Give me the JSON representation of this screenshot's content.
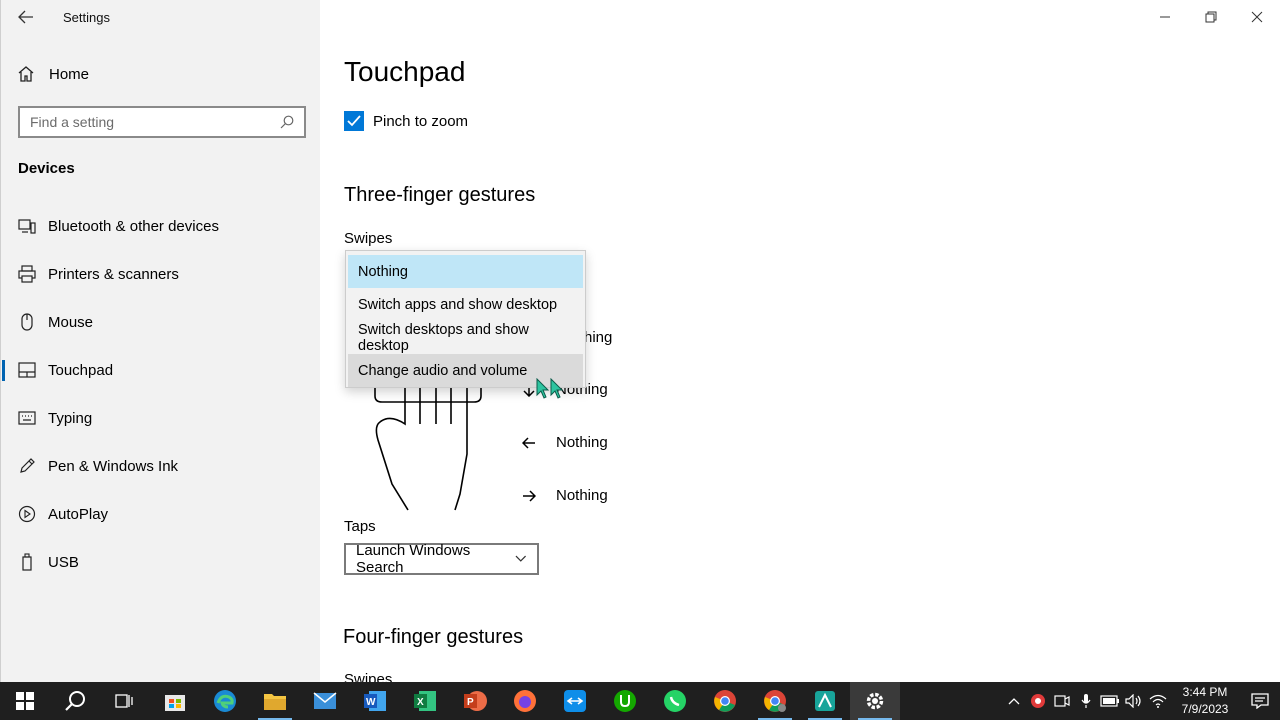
{
  "window": {
    "title": "Settings",
    "back_icon": "back-arrow-icon"
  },
  "sidebar": {
    "home_label": "Home",
    "search_placeholder": "Find a setting",
    "section_title": "Devices",
    "items": [
      {
        "label": "Bluetooth & other devices",
        "icon": "bluetooth-devices-icon"
      },
      {
        "label": "Printers & scanners",
        "icon": "printer-icon"
      },
      {
        "label": "Mouse",
        "icon": "mouse-icon"
      },
      {
        "label": "Touchpad",
        "icon": "touchpad-icon",
        "active": true
      },
      {
        "label": "Typing",
        "icon": "keyboard-icon"
      },
      {
        "label": "Pen & Windows Ink",
        "icon": "pen-icon"
      },
      {
        "label": "AutoPlay",
        "icon": "autoplay-icon"
      },
      {
        "label": "USB",
        "icon": "usb-icon"
      }
    ]
  },
  "main": {
    "page_title": "Touchpad",
    "pinch_to_zoom": {
      "label": "Pinch to zoom",
      "checked": true
    },
    "three_finger": {
      "heading": "Three-finger gestures",
      "swipes_label": "Swipes",
      "partial_text": "hing",
      "gestures": [
        {
          "direction": "down",
          "value": "Nothing"
        },
        {
          "direction": "left",
          "value": "Nothing"
        },
        {
          "direction": "right",
          "value": "Nothing"
        }
      ],
      "taps_label": "Taps",
      "taps_value": "Launch Windows Search"
    },
    "four_finger": {
      "heading": "Four-finger gestures",
      "swipes_label": "Swipes"
    }
  },
  "dropdown": {
    "options": [
      "Nothing",
      "Switch apps and show desktop",
      "Switch desktops and show desktop",
      "Change audio and volume"
    ],
    "selected_index": 0,
    "hover_index": 3
  },
  "taskbar": {
    "apps": [
      "start-icon",
      "search-icon",
      "task-view-icon",
      "store-icon",
      "edge-icon",
      "file-explorer-icon",
      "mail-icon",
      "word-icon",
      "excel-icon",
      "powerpoint-icon",
      "firefox-icon",
      "teamviewer-icon",
      "upwork-icon",
      "whatsapp-icon",
      "chrome-icon",
      "chrome-profile-icon",
      "video-editor-icon",
      "settings-icon"
    ],
    "time": "3:44 PM",
    "date": "7/9/2023"
  },
  "colors": {
    "accent": "#0078d7",
    "selected_option": "#bfe6f7",
    "hover_option": "#dadada",
    "sidebar_bg": "#f2f2f2",
    "taskbar_bg": "#1f1f1f"
  }
}
